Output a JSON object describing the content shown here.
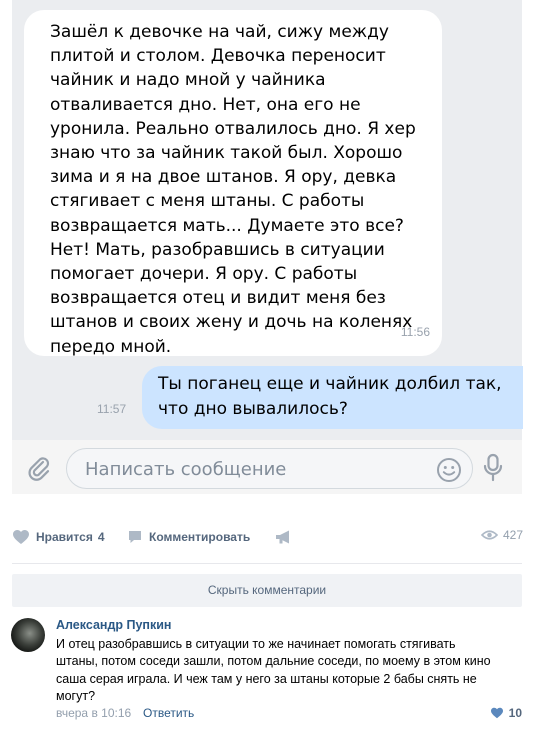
{
  "chat": {
    "incoming_message": {
      "lines": [
        "Зашёл к девочке на чай, сижу между",
        "плитой и столом. Девочка переносит",
        "чайник и надо мной у чайника",
        "отваливается дно. Нет, она его не",
        "уронила. Реально отвалилось дно. Я хер",
        "знаю что за чайник такой был. Хорошо",
        "зима и я на двое штанов. Я ору, девка",
        "стягивает с меня штаны. С работы",
        "возвращается мать... Думаете это все?",
        "Нет! Мать, разобравшись в ситуации",
        "помогает дочери. Я ору. С работы",
        "возвращается отец и видит меня без",
        "штанов и своих жену и дочь на коленях",
        "передо мной."
      ],
      "time": "11:56"
    },
    "outgoing_message": {
      "lines": [
        "Ты поганец еще и чайник долбил так,",
        "что дно вывалилось?"
      ],
      "time": "11:57"
    },
    "composer": {
      "placeholder": "Написать сообщение"
    }
  },
  "post_actions": {
    "like_label": "Нравится",
    "like_count": "4",
    "comment_label": "Комментировать",
    "views_count": "427"
  },
  "comments": {
    "hide_label": "Скрыть комментарии",
    "items": [
      {
        "author": "Александр Пупкин",
        "text_lines": [
          "И отец разобравшись в ситуации то же начинает помогать стягивать",
          "штаны, потом соседи зашли, потом дальние соседи, по моему в этом кино",
          "саша серая играла. И чеж там у него за штаны которые 2 бабы снять не",
          "могут?"
        ],
        "date": "вчера в 10:16",
        "reply_label": "Ответить",
        "likes": "10"
      }
    ]
  },
  "colors": {
    "chat_bg": "#ebedf0",
    "outgoing_bubble": "#cce4ff",
    "link_blue": "#2a5885",
    "action_gray": "#55677d",
    "muted_gray": "#939fad"
  }
}
